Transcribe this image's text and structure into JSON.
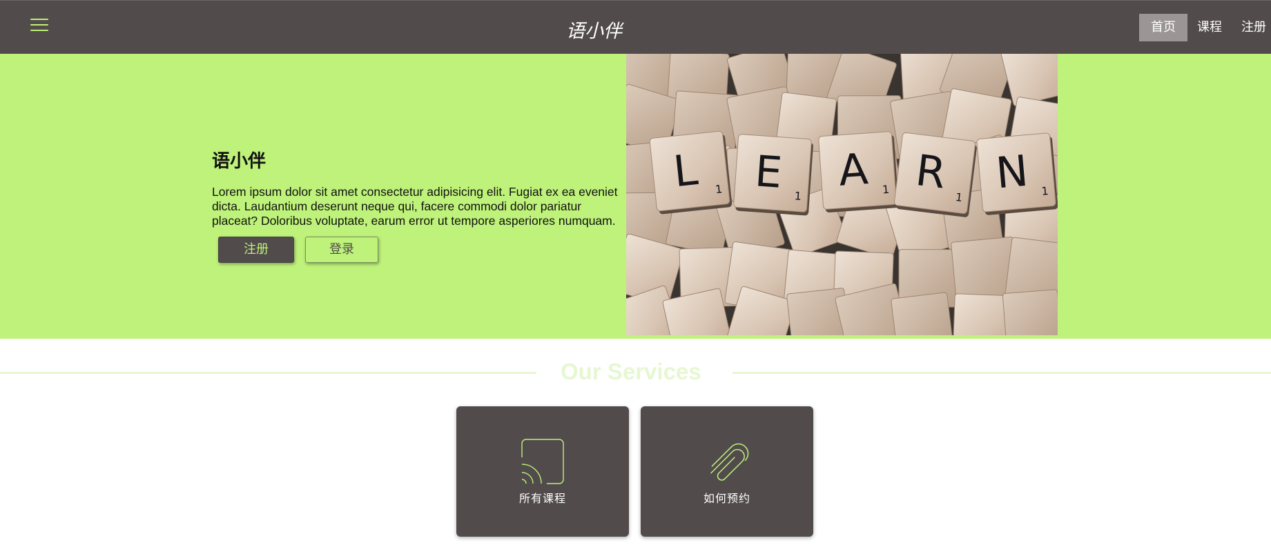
{
  "header": {
    "brand": "语小伴",
    "nav": [
      {
        "label": "首页",
        "active": true
      },
      {
        "label": "课程",
        "active": false
      },
      {
        "label": "注册",
        "active": false
      }
    ]
  },
  "hero": {
    "title": "语小伴",
    "text": "Lorem ipsum dolor sit amet consectetur adipisicing elit. Fugiat ex ea eveniet dicta. Laudantium deserunt neque qui, facere commodi dolor pariatur placeat? Doloribus voluptate, earum error ut tempore asperiores numquam.",
    "register_label": "注册",
    "login_label": "登录",
    "image_tiles": [
      "L",
      "E",
      "A",
      "R",
      "N"
    ],
    "tile_score": "1"
  },
  "services": {
    "title": "Our Services",
    "cards": [
      {
        "label": "所有课程",
        "icon": "cast-icon"
      },
      {
        "label": "如何预约",
        "icon": "paperclip-icon"
      }
    ]
  },
  "colors": {
    "accent": "#bef27a",
    "dark": "#524b4c"
  }
}
